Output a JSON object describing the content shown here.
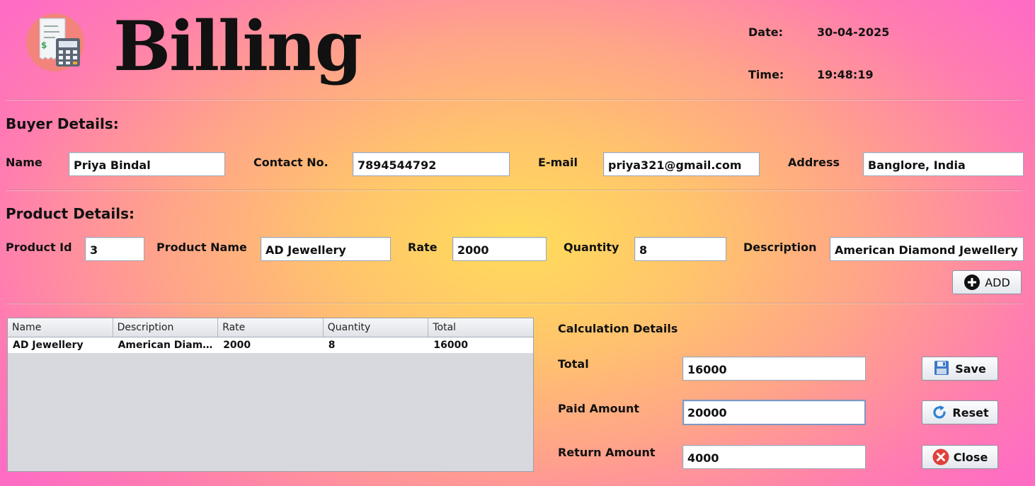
{
  "header": {
    "title": "Billing",
    "date_label": "Date:",
    "date_value": "30-04-2025",
    "time_label": "Time:",
    "time_value": "19:48:19"
  },
  "buyer": {
    "heading": "Buyer Details:",
    "name_label": "Name",
    "name_value": "Priya Bindal",
    "contact_label": "Contact No.",
    "contact_value": "7894544792",
    "email_label": "E-mail",
    "email_value": "priya321@gmail.com",
    "address_label": "Address",
    "address_value": "Banglore, India"
  },
  "product": {
    "heading": "Product Details:",
    "id_label": "Product Id",
    "id_value": "3",
    "name_label": "Product Name",
    "name_value": "AD Jewellery",
    "rate_label": "Rate",
    "rate_value": "2000",
    "quantity_label": "Quantity",
    "quantity_value": "8",
    "description_label": "Description",
    "description_value": "American Diamond Jewellery",
    "add_label": "ADD"
  },
  "table": {
    "columns": [
      "Name",
      "Description",
      "Rate",
      "Quantity",
      "Total"
    ],
    "rows": [
      [
        "AD Jewellery",
        "American Diamond Jewellery",
        "2000",
        "8",
        "16000"
      ]
    ]
  },
  "calculation": {
    "heading": "Calculation Details",
    "total_label": "Total",
    "total_value": "16000",
    "paid_label": "Paid Amount",
    "paid_value": "20000",
    "return_label": "Return Amount",
    "return_value": "4000"
  },
  "actions": {
    "save_label": "Save",
    "reset_label": "Reset",
    "close_label": "Close"
  },
  "colors": {
    "bg_center": "#ffdc5a",
    "bg_edge": "#ff6cc4",
    "close_icon": "#e0413c",
    "reset_icon": "#2f7fd6",
    "save_icon": "#3d78c8"
  },
  "icons": {
    "logo": "receipt-calculator-icon",
    "add": "plus-circle-icon",
    "save": "floppy-disk-icon",
    "reset": "refresh-icon",
    "close": "close-circle-icon"
  }
}
